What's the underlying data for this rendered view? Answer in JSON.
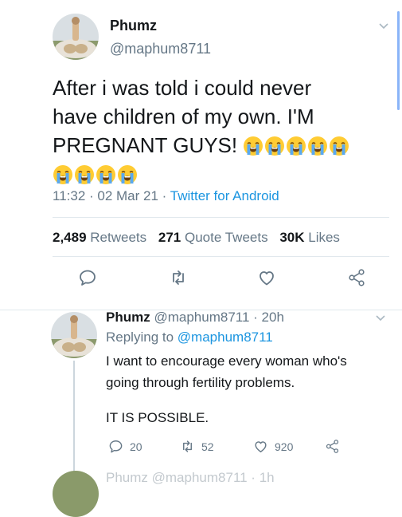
{
  "tweet": {
    "name": "Phumz",
    "handle": "@maphum8711",
    "text_line1": "After i was told i could never",
    "text_line2": "have children of my own. I'M",
    "text_line3": "PREGNANT GUYS!",
    "emoji_count_line3": 5,
    "emoji_count_line4": 4,
    "emoji": "loudly-crying-face",
    "time": "11:32",
    "date": "02 Mar 21",
    "source": "Twitter for Android",
    "retweets_count": "2,489",
    "retweets_label": "Retweets",
    "quotes_count": "271",
    "quotes_label": "Quote Tweets",
    "likes_count": "30K",
    "likes_label": "Likes"
  },
  "reply": {
    "name": "Phumz",
    "handle": "@maphum8711",
    "age": "20h",
    "replying_label": "Replying to",
    "replying_to": "@maphum8711",
    "text_line1": "I want to encourage every woman who's",
    "text_line2": "going through fertility problems.",
    "text_para2": "IT IS POSSIBLE.",
    "reply_count": "20",
    "retweet_count": "52",
    "like_count": "920"
  },
  "next_reply": {
    "header_partial": "Phumz @maphum8711 · 1h"
  },
  "colors": {
    "link": "#1b95e0",
    "muted": "#657786",
    "text": "#14171a",
    "divider": "#e1e8ed"
  }
}
